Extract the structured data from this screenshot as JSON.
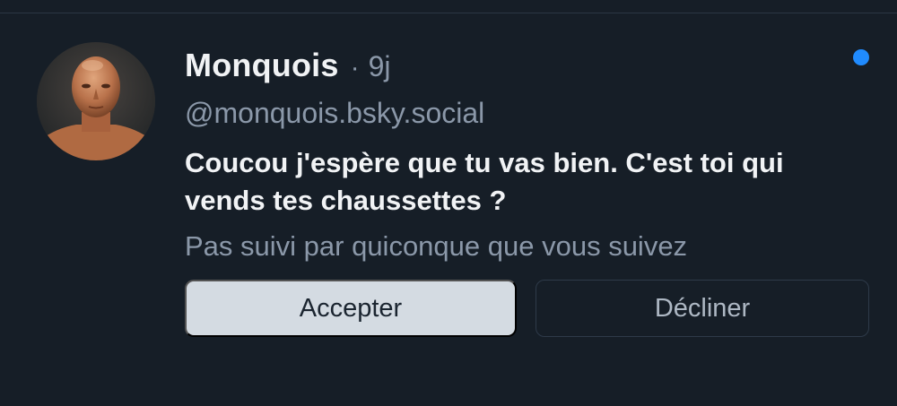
{
  "request": {
    "display_name": "Monquois",
    "separator": "·",
    "time_ago": "9j",
    "handle": "@monquois.bsky.social",
    "message": "Coucou j'espère que tu vas bien. C'est toi qui vends tes chaussettes ?",
    "follow_info": "Pas suivi par quiconque que vous suivez",
    "unread": true
  },
  "actions": {
    "accept_label": "Accepter",
    "decline_label": "Décliner"
  },
  "colors": {
    "background": "#161e27",
    "accent_unread": "#208bfe",
    "primary_text": "#f1f3f5",
    "secondary_text": "#8b98a9",
    "accept_button_bg": "#d4dbe2"
  },
  "icons": {
    "avatar": "profile-photo",
    "unread_indicator": "unread-dot-icon"
  }
}
